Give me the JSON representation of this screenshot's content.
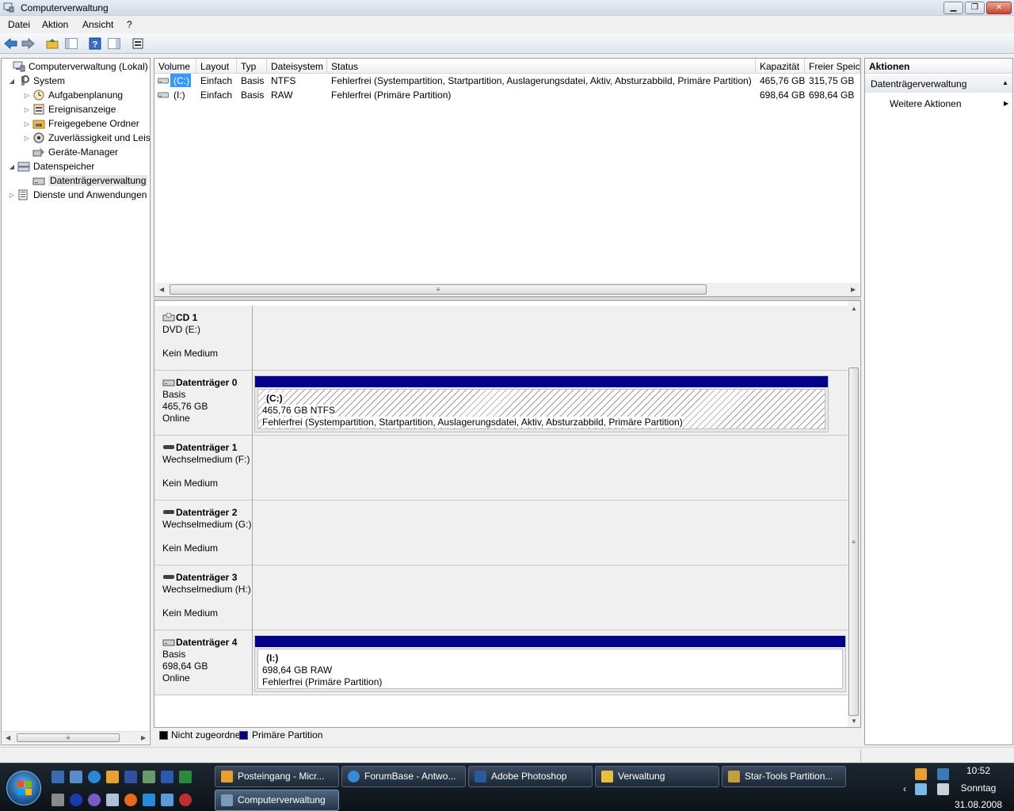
{
  "window": {
    "title": "Computerverwaltung",
    "min_glyph": "▁",
    "max_glyph": "❐",
    "close_glyph": "✕"
  },
  "menu": [
    "Datei",
    "Aktion",
    "Ansicht",
    "?"
  ],
  "toolbar": {
    "buttons": [
      "back-icon",
      "forward-icon",
      "up-folder-icon",
      "show-hide-tree-icon",
      "help-icon",
      "show-hide-action-pane-icon",
      "properties-icon"
    ]
  },
  "tree": {
    "items": [
      {
        "label": "Computerverwaltung (Lokal)",
        "icon": "computer-management-icon",
        "expander": ""
      },
      {
        "label": "System",
        "icon": "system-tools-icon",
        "expander": "◢"
      },
      {
        "label": "Aufgabenplanung",
        "icon": "task-scheduler-icon",
        "expander": "▷"
      },
      {
        "label": "Ereignisanzeige",
        "icon": "event-viewer-icon",
        "expander": "▷"
      },
      {
        "label": "Freigegebene Ordner",
        "icon": "shared-folders-icon",
        "expander": "▷"
      },
      {
        "label": "Zuverlässigkeit und Leis",
        "icon": "reliability-icon",
        "expander": "▷"
      },
      {
        "label": "Geräte-Manager",
        "icon": "device-manager-icon",
        "expander": ""
      },
      {
        "label": "Datenspeicher",
        "icon": "storage-icon",
        "expander": "◢"
      },
      {
        "label": "Datenträgerverwaltung",
        "icon": "disk-management-icon",
        "expander": ""
      },
      {
        "label": "Dienste und Anwendungen",
        "icon": "services-icon",
        "expander": "▷"
      }
    ]
  },
  "volumes": {
    "headers": [
      "Volume",
      "Layout",
      "Typ",
      "Dateisystem",
      "Status",
      "Kapazität",
      "Freier Speic"
    ],
    "rows": [
      {
        "volume": "(C:)",
        "layout": "Einfach",
        "typ": "Basis",
        "fs": "NTFS",
        "status": "Fehlerfrei (Systempartition, Startpartition, Auslagerungsdatei, Aktiv, Absturzabbild, Primäre Partition)",
        "capacity": "465,76 GB",
        "free": "315,75 GB"
      },
      {
        "volume": "(I:)",
        "layout": "Einfach",
        "typ": "Basis",
        "fs": "RAW",
        "status": "Fehlerfrei (Primäre Partition)",
        "capacity": "698,64 GB",
        "free": "698,64 GB"
      }
    ]
  },
  "disks": [
    {
      "name": "CD 1",
      "line2": "DVD (E:)",
      "line3": "",
      "line4": "Kein Medium",
      "icon": "cd-drive-icon"
    },
    {
      "name": "Datenträger 0",
      "line2": "Basis",
      "line3": "465,76 GB",
      "line4": "Online",
      "icon": "hard-disk-icon",
      "partition": {
        "name": "(C:)",
        "size": "465,76 GB NTFS",
        "status": "Fehlerfrei (Systempartition, Startpartition, Auslagerungsdatei, Aktiv, Absturzabbild, Primäre Partition)"
      }
    },
    {
      "name": "Datenträger 1",
      "line2": "Wechselmedium (F:)",
      "line3": "",
      "line4": "Kein Medium",
      "icon": "removable-drive-icon"
    },
    {
      "name": "Datenträger 2",
      "line2": "Wechselmedium (G:)",
      "line3": "",
      "line4": "Kein Medium",
      "icon": "removable-drive-icon"
    },
    {
      "name": "Datenträger 3",
      "line2": "Wechselmedium (H:)",
      "line3": "",
      "line4": "Kein Medium",
      "icon": "removable-drive-icon"
    },
    {
      "name": "Datenträger 4",
      "line2": "Basis",
      "line3": "698,64 GB",
      "line4": "Online",
      "icon": "hard-disk-icon",
      "partition": {
        "name": "(I:)",
        "size": "698,64 GB RAW",
        "status": "Fehlerfrei (Primäre Partition)"
      }
    }
  ],
  "legend": [
    {
      "label": "Nicht zugeordnet",
      "color": "#000000"
    },
    {
      "label": "Primäre Partition",
      "color": "#00008b"
    }
  ],
  "actions": {
    "header": "Aktionen",
    "section": "Datenträgerverwaltung",
    "item": "Weitere Aktionen"
  },
  "taskbar": {
    "buttons": [
      {
        "label": "Posteingang - Micr...",
        "icon": "outlook-icon",
        "color": "#e8a030"
      },
      {
        "label": "ForumBase - Antwo...",
        "icon": "internet-explorer-icon",
        "color": "#3a88d8"
      },
      {
        "label": "Adobe Photoshop",
        "icon": "photoshop-icon",
        "color": "#2a5a9a"
      },
      {
        "label": "Verwaltung",
        "icon": "folder-icon",
        "color": "#e8c040"
      },
      {
        "label": "Star-Tools Partition...",
        "icon": "star-tools-icon",
        "color": "#c0a040"
      },
      {
        "label": "Computerverwaltung",
        "icon": "computer-management-icon",
        "color": "#7a9ab8"
      }
    ],
    "clock_time": "10:52",
    "clock_day": "Sonntag",
    "clock_date": "31.08.2008"
  }
}
